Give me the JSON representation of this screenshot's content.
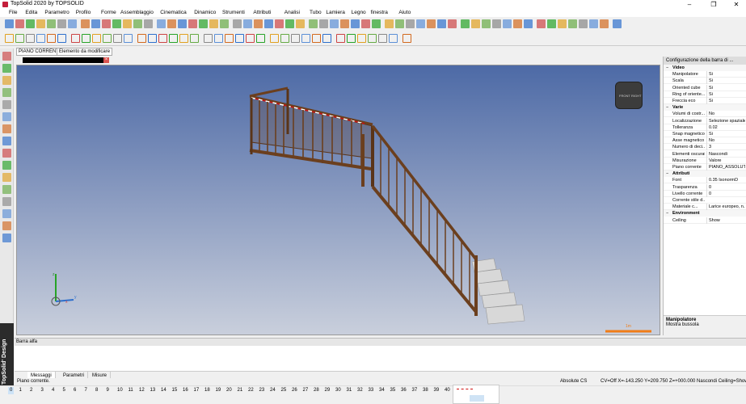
{
  "window": {
    "title": "TopSolid 2020 by TOPSOLID"
  },
  "menu": [
    "File",
    "Edita",
    "Parametro",
    "Profilo",
    "Forme",
    "Assemblaggio",
    "Cinematica",
    "Dinamico",
    "Strumenti",
    "Attributi",
    "Analisi",
    "Tubo",
    "Lamiera",
    "Legno",
    "finestra",
    "Aiuto"
  ],
  "doc_tabs": [
    "PIANO CORRENTE",
    "Elemento da modificare"
  ],
  "brand": "TopSolid' Design",
  "viewcube": {
    "front": "FRONT",
    "right": "RIGHT"
  },
  "scale_label": "1m",
  "axes": {
    "x": "x",
    "y": "y",
    "z": "z"
  },
  "right_panel": {
    "header": "Configurazione della barra di ...",
    "sections": [
      {
        "title": "Video",
        "rows": [
          [
            "Manipolatore",
            "Si"
          ],
          [
            "Scala",
            "Si"
          ],
          [
            "Oriented cube",
            "Si"
          ],
          [
            "Ring of oriente...",
            "Si"
          ],
          [
            "Freccia eco",
            "Si"
          ]
        ]
      },
      {
        "title": "Varie",
        "rows": [
          [
            "Volumi di costr...",
            "No"
          ],
          [
            "Localizzazione",
            "Selezione spaziale"
          ],
          [
            "Tolleranza",
            "0.02"
          ],
          [
            "Snap magnetico",
            "Si"
          ],
          [
            "Asse magnetico",
            "No"
          ],
          [
            "Numero di deci...",
            "3"
          ],
          [
            "Elementi oscurati",
            "Nascondi"
          ],
          [
            "Misurazione",
            "Valore"
          ],
          [
            "Piano corrente",
            "PIANO_ASSOLUTO"
          ]
        ]
      },
      {
        "title": "Attributi",
        "rows": [
          [
            "Font",
            "0.35  IsonormD"
          ],
          [
            "Trasparenza",
            "0"
          ],
          [
            "Livello corrente",
            "0"
          ],
          [
            "Corrente stile d...",
            ""
          ],
          [
            "Materiale c...",
            "Larice europeo, n..."
          ]
        ]
      },
      {
        "title": "Environment",
        "rows": [
          [
            "Ceiling",
            "Show"
          ]
        ]
      }
    ],
    "desc_title": "Manipolatore",
    "desc_text": "Mostra bussola"
  },
  "bottom": {
    "header": "Barra alfa",
    "tabs": [
      "Messaggi",
      "Parametri",
      "Misure"
    ]
  },
  "status": {
    "left": "Piano corrente.",
    "abs": "Absolute CS",
    "coords": "CV=Off  X=-143.250  Y=209.750  Z=+000.000  Nascondi  Ceiling=Show"
  },
  "pages": [
    "0",
    "1",
    "2",
    "3",
    "4",
    "5",
    "6",
    "7",
    "8",
    "9",
    "10",
    "11",
    "12",
    "13",
    "14",
    "15",
    "16",
    "17",
    "18",
    "19",
    "20",
    "21",
    "22",
    "23",
    "24",
    "25",
    "26",
    "27",
    "28",
    "29",
    "30",
    "31",
    "32",
    "33",
    "34",
    "35",
    "36",
    "37",
    "38",
    "39",
    "40"
  ]
}
